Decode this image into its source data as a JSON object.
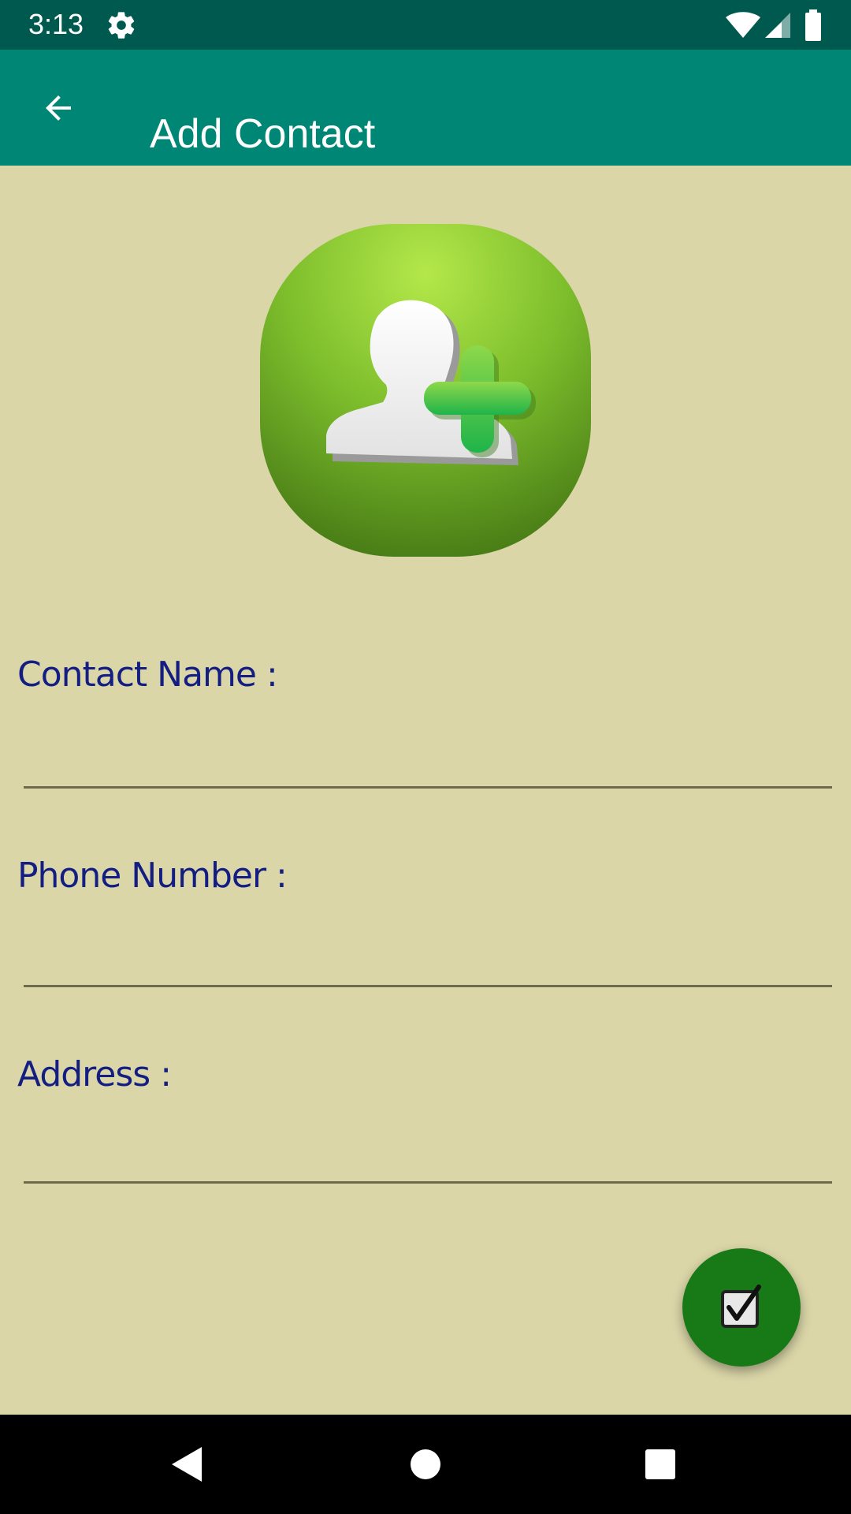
{
  "status_bar": {
    "time": "3:13",
    "icons": [
      "gear-icon",
      "wifi-icon",
      "signal-icon",
      "battery-icon"
    ]
  },
  "app_bar": {
    "title": "Add Contact",
    "back_icon": "arrow-back-icon",
    "background_color": "#008675"
  },
  "hero": {
    "icon": "add-contact-icon"
  },
  "form": {
    "contact_name": {
      "label": "Contact Name :",
      "value": ""
    },
    "phone_number": {
      "label": "Phone Number :",
      "value": ""
    },
    "address": {
      "label": "Address :",
      "value": ""
    }
  },
  "fab": {
    "icon": "checkbox-checked-icon",
    "color": "#177A17"
  },
  "nav_bar": {
    "icons": [
      "back-triangle-icon",
      "home-circle-icon",
      "recents-square-icon"
    ]
  },
  "colors": {
    "background": "#DAD6A8",
    "status_bar": "#00594F",
    "label_text": "#141E82"
  }
}
